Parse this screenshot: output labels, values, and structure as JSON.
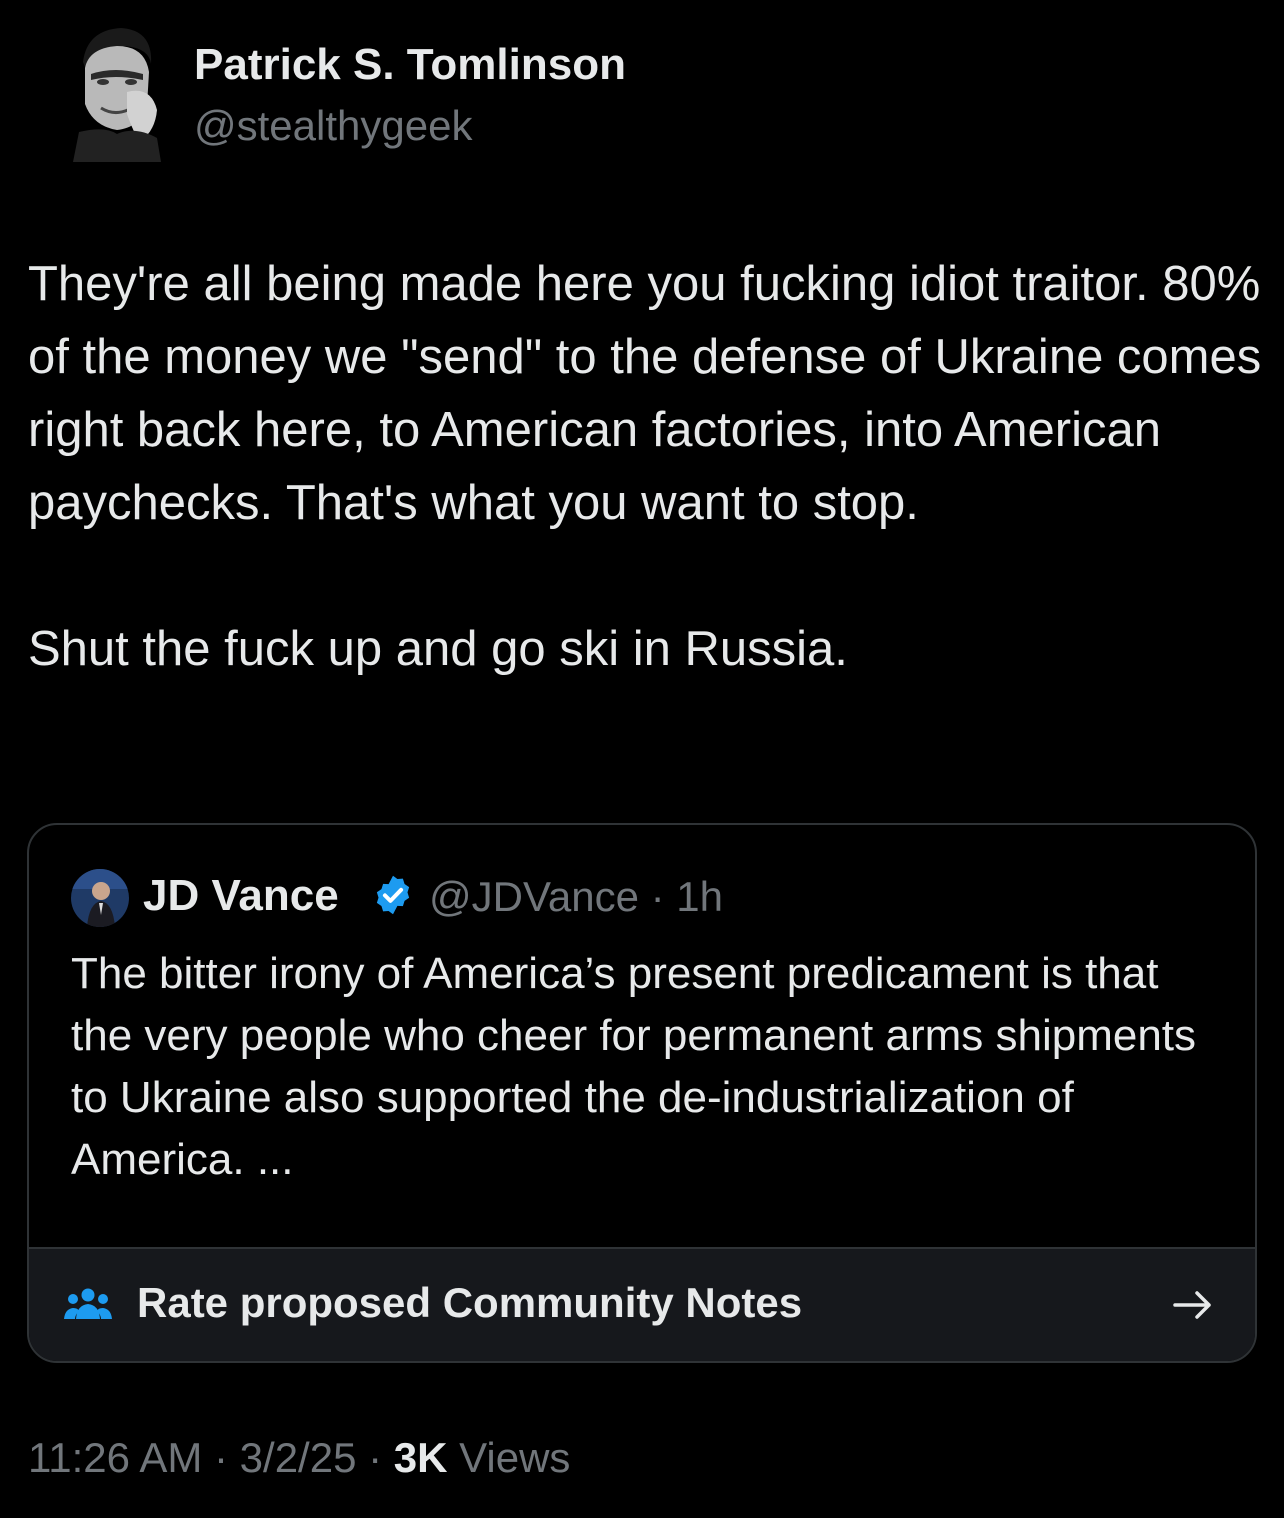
{
  "author": {
    "name": "Patrick S. Tomlinson",
    "handle": "@stealthygeek"
  },
  "tweet": {
    "paragraph_1": "They're all being made here you fucking idiot traitor. 80% of the money we \"send\" to the defense of Ukraine comes right back here, to American factories, into American paychecks. That's what you want to stop.",
    "paragraph_2": "Shut the fuck up and go ski in Russia."
  },
  "quoted_tweet": {
    "name": "JD Vance",
    "handle_time": "@JDVance · 1h",
    "text": "The bitter irony of America’s present predicament is that the very people who cheer for permanent arms shipments to Ukraine also supported the de-industrialization of America. ...",
    "verified_icon": "verified-badge-icon",
    "verified_color": "#1d9bf0"
  },
  "community_notes": {
    "label": "Rate proposed Community Notes",
    "icon": "people-icon",
    "icon_color": "#1d9bf0",
    "arrow_icon": "arrow-right-icon"
  },
  "meta": {
    "time_date": "11:26 AM · 3/2/25 · ",
    "views_count": "3K",
    "views_label": " Views"
  },
  "colors": {
    "background": "#000000",
    "primary_text": "#e7e9ea",
    "secondary_text": "#71767b",
    "border": "#2f3336"
  }
}
